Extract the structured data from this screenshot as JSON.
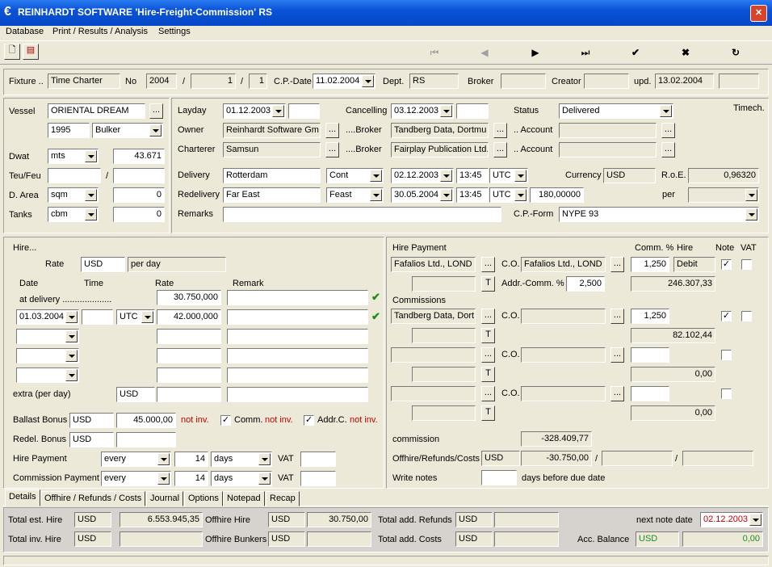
{
  "window": {
    "title": "REINHARDT SOFTWARE 'Hire-Freight-Commission'  RS"
  },
  "menu": [
    "Database",
    "Print / Results / Analysis",
    "Settings"
  ],
  "fixture": {
    "label": "Fixture ..",
    "type": "Time Charter",
    "no_label": "No",
    "no": "2004",
    "sep1": "/",
    "sub1": "",
    "sep2": "1",
    "sep3": "/",
    "sub2": "1",
    "cpdate_label": "C.P.-Date",
    "cpdate": "11.02.2004",
    "dept_label": "Dept.",
    "dept": "RS",
    "broker_label": "Broker",
    "broker": "",
    "creator_label": "Creator",
    "creator": "",
    "upd_label": "upd.",
    "upd": "13.02.2004",
    "extra": ""
  },
  "vessel": {
    "label": "Vessel",
    "name": "ORIENTAL DREAM",
    "year": "1995",
    "type": "Bulker",
    "dwat_label": "Dwat",
    "dwat_unit": "mts",
    "dwat": "43.671",
    "teu_label": "Teu/Feu",
    "teu_sep": "/",
    "darea_label": "D. Area",
    "darea_unit": "sqm",
    "darea": "0",
    "tanks_label": "Tanks",
    "tanks_unit": "cbm",
    "tanks": "0"
  },
  "parties": {
    "layday_label": "Layday",
    "layday": "01.12.2003",
    "cancel_label": "Cancelling",
    "cancel": "03.12.2003",
    "status_label": "Status",
    "status": "Delivered",
    "timech": "Timech.",
    "owner_label": "Owner",
    "owner": "Reinhardt Software Gm",
    "broker1_label": "....Broker",
    "broker1": "Tandberg Data, Dortmu",
    "account1_label": ".. Account",
    "charterer_label": "Charterer",
    "charterer": "Samsun",
    "broker2_label": "....Broker",
    "broker2": "Fairplay Publication Ltd.,",
    "account2_label": ".. Account",
    "delivery_label": "Delivery",
    "delivery": "Rotterdam",
    "delivery_term": "Cont",
    "delivery_date": "02.12.2003",
    "delivery_time": "13:45",
    "delivery_tz": "UTC",
    "currency_label": "Currency",
    "currency": "USD",
    "roe_label": "R.o.E.",
    "roe": "0,96320",
    "redelivery_label": "Redelivery",
    "redelivery": "Far East",
    "redelivery_term": "Feast",
    "redelivery_date": "30.05.2004",
    "redelivery_time": "13:45",
    "redelivery_tz": "UTC",
    "redelivery_days": "180,00000",
    "per_label": "per",
    "remarks_label": "Remarks",
    "cpform_label": "C.P.-Form",
    "cpform": "NYPE 93"
  },
  "hire": {
    "title": "Hire...",
    "rate_label": "Rate",
    "rate_cur": "USD",
    "rate_unit": "per day",
    "h_date": "Date",
    "h_time": "Time",
    "h_rate": "Rate",
    "h_remark": "Remark",
    "atdel": "at delivery ....................",
    "atdel_rate": "30.750,000",
    "row1_date": "01.03.2004",
    "row1_tz": "UTC",
    "row1_rate": "42.000,000",
    "extra_label": "extra (per day)",
    "extra_cur": "USD",
    "ballast_label": "Ballast Bonus",
    "ballast_cur": "USD",
    "ballast": "45.000,00",
    "notinv1": "not inv.",
    "comm_label": "Comm.",
    "notinv2": "not inv.",
    "addrc_label": "Addr.C.",
    "notinv3": "not inv.",
    "redel_label": "Redel. Bonus",
    "redel_cur": "USD",
    "hirepay_label": "Hire Payment",
    "hirepay_every": "every",
    "hirepay_n": "14",
    "hirepay_unit": "days",
    "vat1": "VAT",
    "commpay_label": "Commission Payment",
    "commpay_every": "every",
    "commpay_n": "14",
    "commpay_unit": "days",
    "vat2": "VAT"
  },
  "payment": {
    "title": "Hire Payment",
    "comm_pct": "Comm. %",
    "hire_col": "Hire",
    "note_col": "Note",
    "vat_col": "VAT",
    "payer": "Fafalios Ltd., LOND",
    "co_label": "C.O.",
    "co": "Fafalios Ltd., LOND",
    "pct": "1,250",
    "debit": "Debit",
    "addr_label": "Addr.-Comm. %",
    "addr": "2,500",
    "amount": "246.307,33",
    "commissions_label": "Commissions",
    "c1_name": "Tandberg Data, Dort",
    "c1_pct": "1,250",
    "c1_amount": "82.102,44",
    "c2_amount": "0,00",
    "c3_amount": "0,00",
    "commission_label": "commission",
    "commission": "-328.409,77",
    "offhire_label": "Offhire/Refunds/Costs",
    "offhire_cur": "USD",
    "offhire": "-30.750,00",
    "sep": "/",
    "writenotes_label": "Write notes",
    "due_label": "days before due date",
    "t": "T"
  },
  "tabs": [
    "Details",
    "Offhire / Refunds / Costs",
    "Journal",
    "Options",
    "Notepad",
    "Recap"
  ],
  "totals": {
    "esthire_label": "Total est. Hire",
    "esthire_cur": "USD",
    "esthire": "6.553.945,35",
    "offhire_label": "Offhire Hire",
    "offhire_cur": "USD",
    "offhire": "30.750,00",
    "addref_label": "Total add. Refunds",
    "addref_cur": "USD",
    "nextnote_label": "next note date",
    "nextnote": "02.12.2003",
    "invhire_label": "Total inv. Hire",
    "invhire_cur": "USD",
    "offbunk_label": "Offhire Bunkers",
    "offbunk_cur": "USD",
    "addcost_label": "Total add. Costs",
    "addcost_cur": "USD",
    "accbal_label": "Acc. Balance",
    "accbal_cur": "USD",
    "accbal": "0,00"
  },
  "colors": {
    "titlebar": "#0A5ADB",
    "window_bg": "#ECE9D8",
    "red": "#C00000",
    "green": "#1F8C1F"
  }
}
